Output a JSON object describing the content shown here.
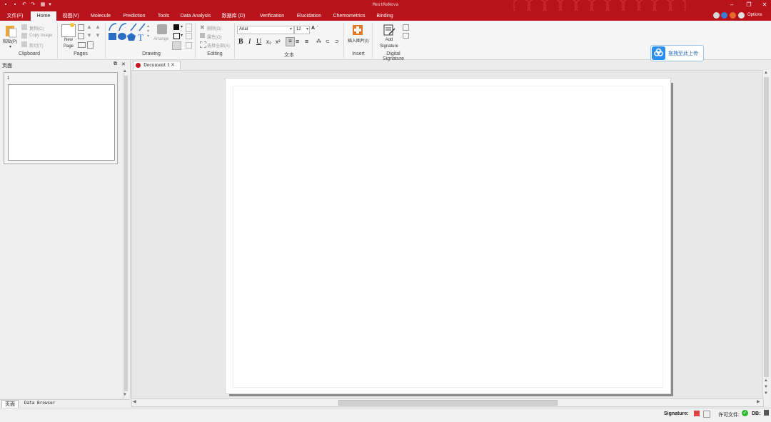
{
  "window": {
    "title": "MestReNova"
  },
  "quick_access": [
    "app-icon",
    "save-icon",
    "undo-icon",
    "redo-icon",
    "print-icon",
    "dropdown-icon"
  ],
  "tabs": [
    {
      "label": "文件(F)",
      "active": false
    },
    {
      "label": "Home",
      "active": true
    },
    {
      "label": "视图(V)",
      "active": false
    },
    {
      "label": "Molecule",
      "active": false
    },
    {
      "label": "Prediction",
      "active": false
    },
    {
      "label": "Tools",
      "active": false
    },
    {
      "label": "Data Analysis",
      "active": false
    },
    {
      "label": "数据库 (D)",
      "active": false
    },
    {
      "label": "Verification",
      "active": false
    },
    {
      "label": "Elucidation",
      "active": false
    },
    {
      "label": "Chemometrics",
      "active": false
    },
    {
      "label": "Binding",
      "active": false
    }
  ],
  "options_label": "Options",
  "ribbon": {
    "clipboard": {
      "paste": "粘贴(P)",
      "copy": "复制(C)",
      "copy_image": "Copy Image",
      "cut": "剪切(T)",
      "group": "Clipboard"
    },
    "pages": {
      "new_page": "New Page",
      "group": "Pages"
    },
    "drawing": {
      "arrange": "Arrange",
      "group": "Drawing"
    },
    "editing": {
      "delete": "删除(D)",
      "properties": "属性(O)",
      "select_all": "选择全部(A)",
      "group": "Editing"
    },
    "text": {
      "font": "Arial",
      "size": "12",
      "group": "文本"
    },
    "insert": {
      "insert_image": "插入图片(I)",
      "group": "Insert"
    },
    "signature": {
      "add": "Add Signature",
      "group": "Digital Signature"
    },
    "upload": {
      "label": "拖拽至此上传"
    }
  },
  "left_panel": {
    "title": "页面",
    "page_number": "1",
    "bottom_tabs": [
      "页面",
      "Data Browser"
    ]
  },
  "document": {
    "tab_label": "Document 1"
  },
  "status": {
    "signature": "Signature:",
    "license": "许可文件:",
    "db": "DB:"
  },
  "colors": {
    "brand": "#b8121a",
    "active_tab": "#f5f5f5",
    "ok": "#2eb82e"
  }
}
